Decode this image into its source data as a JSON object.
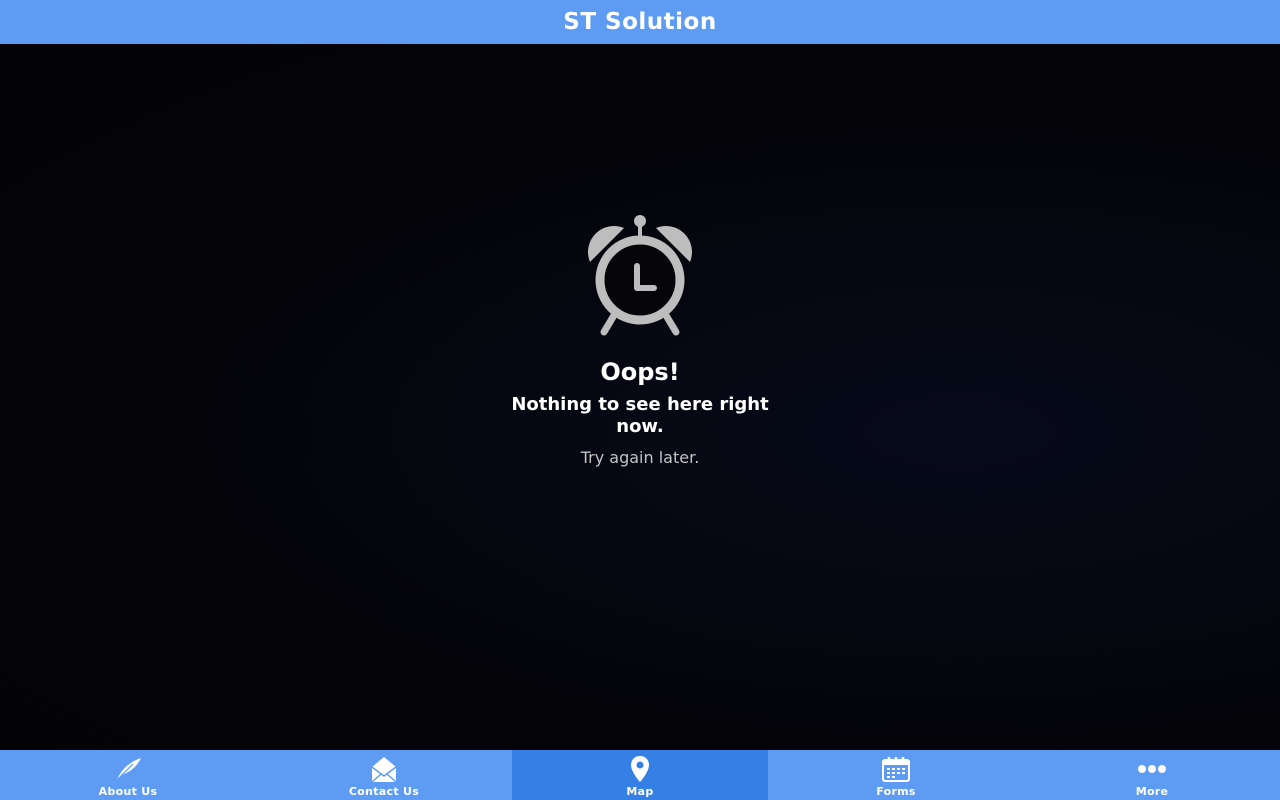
{
  "header": {
    "title": "ST Solution"
  },
  "empty_state": {
    "title": "Oops!",
    "message": "Nothing to see here right now.",
    "hint": "Try again later.",
    "icon": "alarm-clock-icon"
  },
  "tabbar": {
    "active_tab": "Map",
    "tabs": [
      {
        "label": "About Us",
        "icon": "feather-icon"
      },
      {
        "label": "Contact Us",
        "icon": "envelope-icon"
      },
      {
        "label": "Map",
        "icon": "map-pin-icon"
      },
      {
        "label": "Forms",
        "icon": "calendar-icon"
      },
      {
        "label": "More",
        "icon": "more-dots-icon"
      }
    ]
  },
  "colors": {
    "header_bg": "#5e9cf3",
    "tabbar_bg": "#5e9cf3",
    "tab_active_bg": "#3580e4",
    "content_bg": "#05050a",
    "icon_gray": "#bdbdbd"
  }
}
